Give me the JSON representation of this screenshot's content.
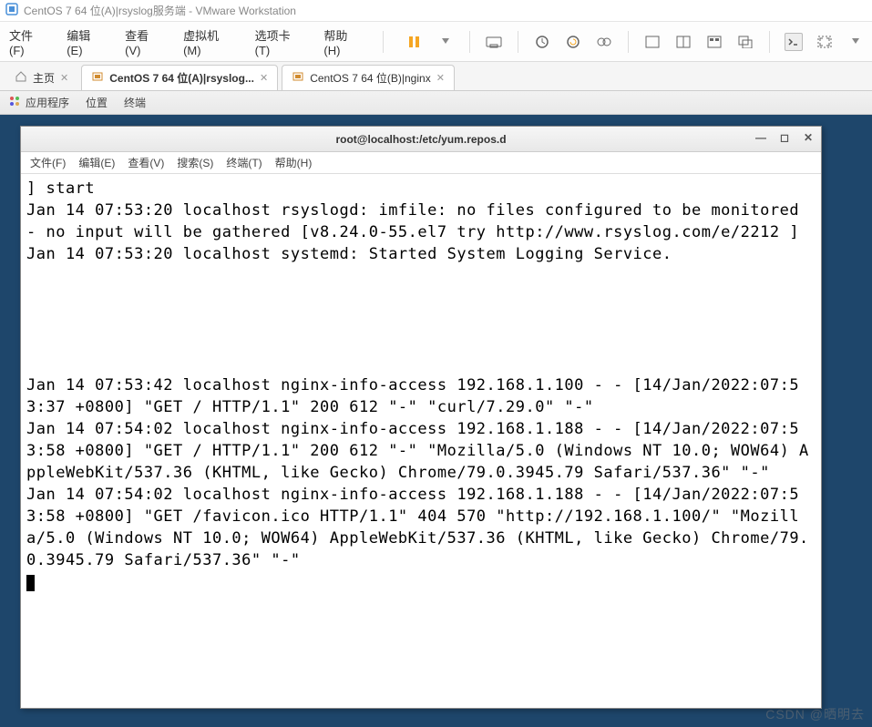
{
  "outer_title": "CentOS 7 64 位(A)|rsyslog服务端 - VMware Workstation",
  "menubar": {
    "file": "文件(F)",
    "edit": "编辑(E)",
    "view": "查看(V)",
    "vm": "虚拟机(M)",
    "tabs": "选项卡(T)",
    "help": "帮助(H)"
  },
  "tabbar": {
    "home_label": "主页",
    "tab1_label": "CentOS 7 64 位(A)|rsyslog...",
    "tab2_label": "CentOS 7 64 位(B)|nginx"
  },
  "guestbar": {
    "apps": "应用程序",
    "places": "位置",
    "terminal": "终端"
  },
  "terminal": {
    "title": "root@localhost:/etc/yum.repos.d",
    "menus": {
      "file": "文件(F)",
      "edit": "编辑(E)",
      "view": "查看(V)",
      "search": "搜索(S)",
      "terminal": "终端(T)",
      "help": "帮助(H)"
    },
    "lines": [
      "] start",
      "Jan 14 07:53:20 localhost rsyslogd: imfile: no files configured to be monitored - no input will be gathered [v8.24.0-55.el7 try http://www.rsyslog.com/e/2212 ]",
      "Jan 14 07:53:20 localhost systemd: Started System Logging Service.",
      "",
      "",
      "",
      "",
      "",
      "Jan 14 07:53:42 localhost nginx-info-access 192.168.1.100 - - [14/Jan/2022:07:53:37 +0800] \"GET / HTTP/1.1\" 200 612 \"-\" \"curl/7.29.0\" \"-\"",
      "Jan 14 07:54:02 localhost nginx-info-access 192.168.1.188 - - [14/Jan/2022:07:53:58 +0800] \"GET / HTTP/1.1\" 200 612 \"-\" \"Mozilla/5.0 (Windows NT 10.0; WOW64) AppleWebKit/537.36 (KHTML, like Gecko) Chrome/79.0.3945.79 Safari/537.36\" \"-\"",
      "Jan 14 07:54:02 localhost nginx-info-access 192.168.1.188 - - [14/Jan/2022:07:53:58 +0800] \"GET /favicon.ico HTTP/1.1\" 404 570 \"http://192.168.1.100/\" \"Mozilla/5.0 (Windows NT 10.0; WOW64) AppleWebKit/537.36 (KHTML, like Gecko) Chrome/79.0.3945.79 Safari/537.36\" \"-\""
    ]
  },
  "watermark": "CSDN @晒明去"
}
